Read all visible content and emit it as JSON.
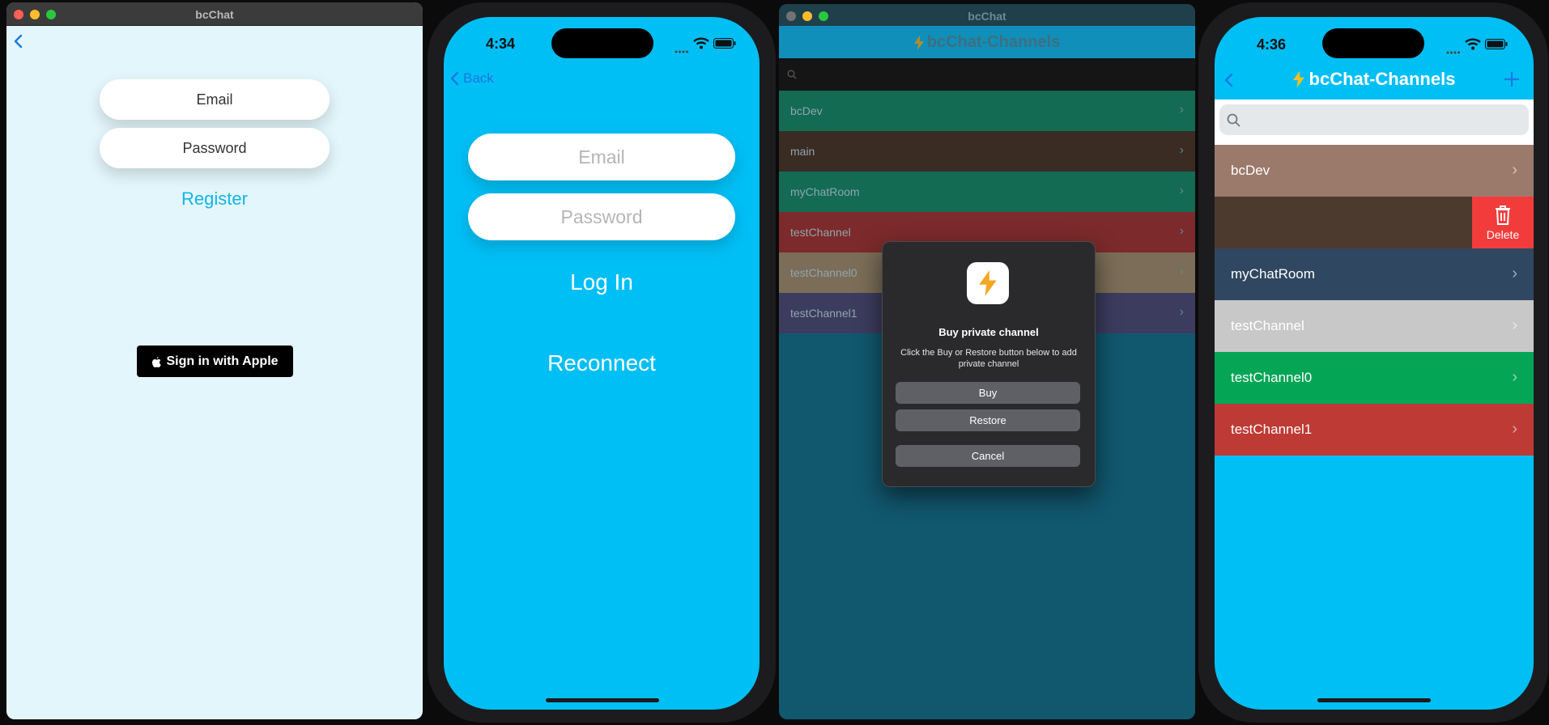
{
  "panel1": {
    "window_title": "bcChat",
    "email_placeholder": "Email",
    "password_placeholder": "Password",
    "register_label": "Register",
    "apple_sign_in_label": "Sign in with Apple"
  },
  "panel2": {
    "time": "4:34",
    "back_label": "Back",
    "email_placeholder": "Email",
    "password_placeholder": "Password",
    "login_label": "Log In",
    "reconnect_label": "Reconnect"
  },
  "panel3": {
    "window_title": "bcChat",
    "nav_title": "bcChat-Channels",
    "channels": [
      {
        "name": "bcDev",
        "color": "#136b54"
      },
      {
        "name": "main",
        "color": "#3a2b23"
      },
      {
        "name": "myChatRoom",
        "color": "#136b54"
      },
      {
        "name": "testChannel",
        "color": "#7c2a2b"
      },
      {
        "name": "testChannel0",
        "color": "#7b6d57"
      },
      {
        "name": "testChannel1",
        "color": "#3c3c5e"
      }
    ],
    "alert": {
      "title": "Buy private channel",
      "message": "Click the Buy or Restore button below to add private channel",
      "buy_label": "Buy",
      "restore_label": "Restore",
      "cancel_label": "Cancel"
    }
  },
  "panel4": {
    "time": "4:36",
    "nav_title": "bcChat-Channels",
    "delete_label": "Delete",
    "channels": [
      {
        "name": "bcDev",
        "color": "#9b7a6b"
      },
      {
        "name": "",
        "color": "#4c3a2f"
      },
      {
        "name": "myChatRoom",
        "color": "#2f4760"
      },
      {
        "name": "testChannel",
        "color": "#c8c8c8"
      },
      {
        "name": "testChannel0",
        "color": "#05a556"
      },
      {
        "name": "testChannel1",
        "color": "#be3a34"
      }
    ]
  },
  "colors": {
    "accent_blue": "#00bff5",
    "delete_red": "#f23c3c",
    "ios_link_blue": "#1b78e3"
  },
  "icons": [
    "chevron-left-icon",
    "apple-logo-icon",
    "wifi-icon",
    "battery-icon",
    "signal-icon",
    "search-icon",
    "lightning-bolt-icon",
    "trash-icon",
    "plus-icon",
    "chevron-right-icon"
  ]
}
